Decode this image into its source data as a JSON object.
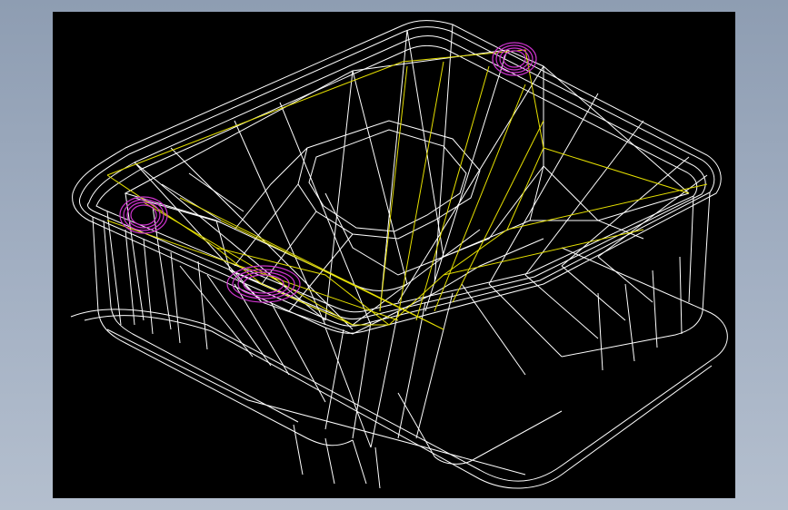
{
  "viewport": {
    "background": "#000000",
    "edge_colors": {
      "wire": "#ffffff",
      "highlight": "#e6e000",
      "selected": "#cc33cc"
    }
  }
}
